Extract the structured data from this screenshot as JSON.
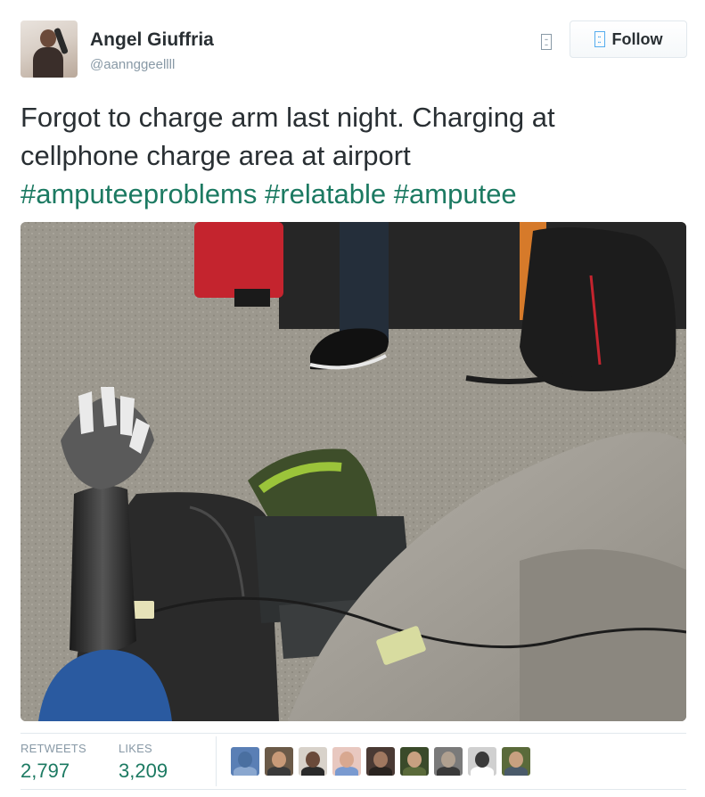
{
  "user": {
    "name": "Angel Giuffria",
    "handle": "@aannggeellll"
  },
  "follow_button": {
    "label": "Follow",
    "icon": "follow-user-icon"
  },
  "tweet": {
    "text_lines": [
      "Forgot to charge arm last night. Charging at",
      "cellphone charge area at airport"
    ],
    "hashtags": [
      "#amputeeproblems",
      "#relatable",
      "#amputee"
    ]
  },
  "media": {
    "type": "photo"
  },
  "stats": {
    "retweets_label": "RETWEETS",
    "retweets_value": "2,797",
    "likes_label": "LIKES",
    "likes_value": "3,209"
  },
  "likers": [
    {
      "bg": "#5a7fb5",
      "face": "#4a6fa0",
      "shirt": "#8aa7cf"
    },
    {
      "bg": "#6b5a48",
      "face": "#c89a78",
      "shirt": "#3a3a3a"
    },
    {
      "bg": "#d8d2ca",
      "face": "#6a4a3a",
      "shirt": "#2a2a2a"
    },
    {
      "bg": "#e8c8c0",
      "face": "#d8a890",
      "shirt": "#7a9ad0"
    },
    {
      "bg": "#4a3a34",
      "face": "#a07860",
      "shirt": "#2a2420"
    },
    {
      "bg": "#3a4a2a",
      "face": "#c8a080",
      "shirt": "#5a6a3a"
    },
    {
      "bg": "#7a7a7a",
      "face": "#b0a090",
      "shirt": "#3a3a3a"
    },
    {
      "bg": "#d0d0d0",
      "face": "#3a3a3a",
      "shirt": "#ffffff"
    },
    {
      "bg": "#5a6a3a",
      "face": "#c8a080",
      "shirt": "#4a5a6a"
    }
  ],
  "colors": {
    "hashtag": "#1c7a62",
    "stat_value": "#1c7a62",
    "muted": "#8899a6",
    "text": "#292f33"
  }
}
